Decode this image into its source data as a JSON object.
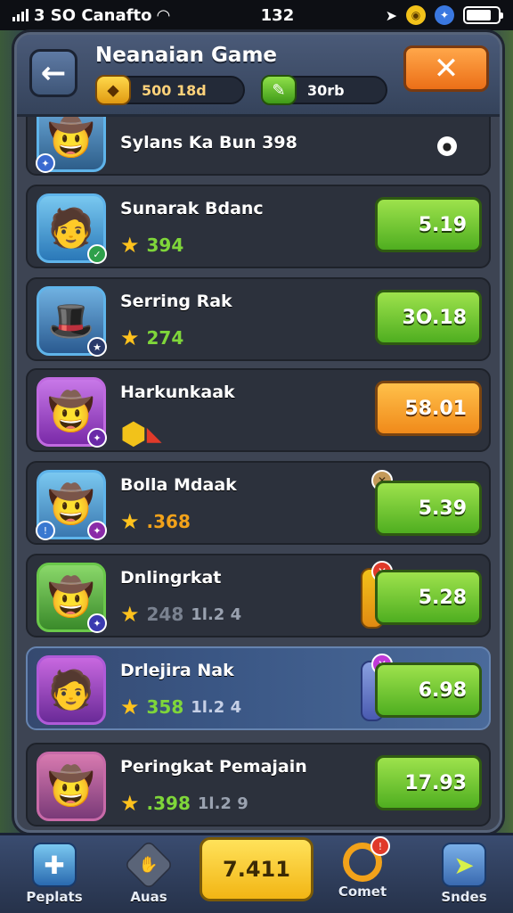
{
  "status": {
    "carrier": "3 SO Canafto",
    "time": "132"
  },
  "header": {
    "title": "Neanaian Game",
    "coins": "500 18d",
    "gems": "30rb",
    "close_glyph": "✕",
    "back_glyph": "←"
  },
  "players": [
    {
      "name": "Sylans Ka Bun 398",
      "score": "",
      "extra": "",
      "value": "",
      "icon": "player-avatar"
    },
    {
      "name": "Sunarak Bdanc",
      "score": "394",
      "extra": "",
      "value": "5.19",
      "icon": "player-avatar"
    },
    {
      "name": "Serring Rak",
      "score": "274",
      "extra": "",
      "value": "3O.18",
      "icon": "player-avatar"
    },
    {
      "name": "Harkunkaak",
      "score": "",
      "extra": "",
      "value": "58.01",
      "icon": "gem-chest-icon"
    },
    {
      "name": "Bolla Mdaak",
      "score": ".368",
      "extra": "",
      "value": "5.39",
      "icon": "player-avatar"
    },
    {
      "name": "Dnlingrkat",
      "score": "248",
      "extra": "1l.2 4",
      "value": "5.28",
      "icon": "player-avatar"
    },
    {
      "name": "Drlejira Nak",
      "score": "358",
      "extra": "1l.2 4",
      "value": "6.98",
      "icon": "player-avatar"
    },
    {
      "name": "Peringkat Pemajain",
      "score": ".398",
      "extra": "1l.2 9",
      "value": "17.93",
      "icon": "player-avatar"
    }
  ],
  "bottom_nav": {
    "items": [
      {
        "label": "Peplats"
      },
      {
        "label": "Auas"
      },
      {
        "label": "Comet"
      },
      {
        "label": "Sndes"
      }
    ],
    "center_value": "7.411"
  }
}
